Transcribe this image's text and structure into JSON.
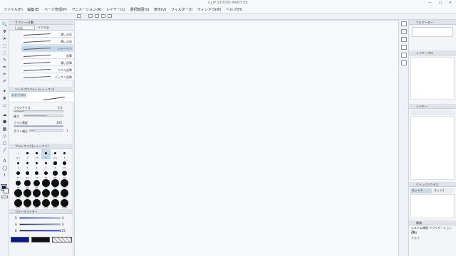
{
  "app": {
    "title": "CLIP STUDIO PAINT EX"
  },
  "window_controls": {
    "minimize": "—",
    "maximize": "□",
    "close": "✕"
  },
  "menu": [
    "ファイル(F)",
    "編集(E)",
    "ページ管理(P)",
    "アニメーション(A)",
    "レイヤー(L)",
    "選択範囲(S)",
    "表示(V)",
    "フィルター(I)",
    "ウィンドウ(W)",
    "ヘルプ(H)"
  ],
  "subtool_panel": {
    "title": "サブツール[筆]",
    "tabs": [
      "水彩",
      "リアル水"
    ],
    "brushes": [
      "濃い水彩",
      "薄い水彩",
      "シャーペン",
      "鉛筆",
      "濃い鉛筆",
      "リアル鉛筆",
      "デッサン鉛筆"
    ],
    "selected_index": 2
  },
  "tool_property": {
    "title": "ツールプロパティ[シャーペン]",
    "current": "シャーペン",
    "brush_size_label": "ブラシサイズ",
    "brush_size_value": "2.0",
    "hardness_label": "硬さ",
    "density_label": "ブラシ濃度",
    "density_value": "100",
    "correction_label": "手ブレ補正",
    "correction_value": "7"
  },
  "brush_size_panel": {
    "title": "ブラシサイズ[シャーペン]",
    "sizes": [
      "0.7",
      "1",
      "1.5",
      "2",
      "2.5",
      "3",
      "4",
      "5",
      "6",
      "7",
      "8",
      "10",
      "12",
      "15",
      "17",
      "20",
      "25",
      "30",
      "40",
      "50",
      "60",
      "70",
      "80",
      "100",
      "120",
      "150",
      "170",
      "200",
      "250",
      "300",
      "400",
      "500",
      "600",
      "700",
      "800",
      "1000"
    ],
    "selected": "2"
  },
  "color_slider": {
    "title": "カラースライダー",
    "channels": [
      {
        "label": "R",
        "value": "0"
      },
      {
        "label": "G",
        "value": "0"
      },
      {
        "label": "B",
        "value": "255"
      }
    ],
    "main_color": "#0a1a8a",
    "sub_color": "#111111"
  },
  "navigator": {
    "title": "ナビゲーター"
  },
  "layer_property": {
    "title": "レイヤープロ"
  },
  "layer_panel": {
    "title": "レイヤー"
  },
  "quick_access": {
    "title": "クイックアクセス",
    "tabs": [
      "セット1",
      "セット2"
    ]
  },
  "info_panel": {
    "title": "情報",
    "lines": [
      "システム情報 アプリケーション 3%",
      "CPU",
      "メモリ"
    ]
  },
  "colors": {
    "accent": "#c5d8ea",
    "canvas": "#f6f9fc",
    "panel": "#f3f5f8"
  }
}
